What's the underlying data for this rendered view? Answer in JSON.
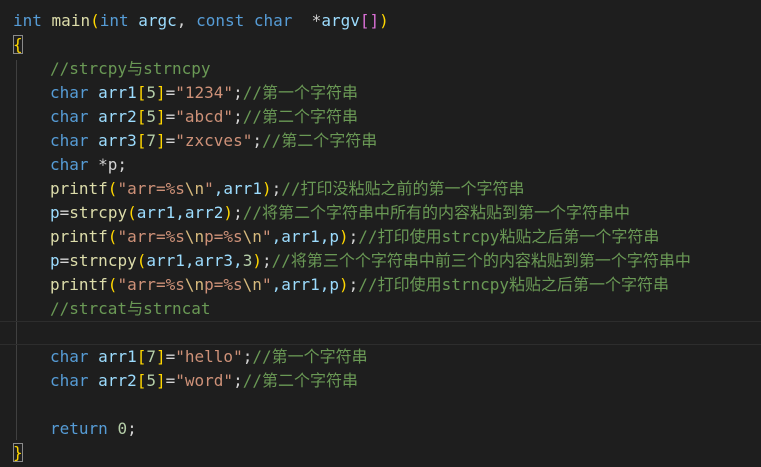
{
  "colors": {
    "background": "#1e1e1e",
    "keyword": "#569cd6",
    "function": "#dcdcaa",
    "variable": "#9cdcfe",
    "number": "#b5cea8",
    "string": "#ce9178",
    "escape": "#d7ba7d",
    "comment": "#6a9955",
    "bracket_gold": "#ffd700",
    "bracket_purple": "#da70d6"
  },
  "code": {
    "l1": {
      "kw_int": "int",
      "fn_main": "main",
      "lp": "(",
      "kw_int2": "int",
      "argc": "argc",
      "comma": ", ",
      "kw_const": "const",
      "kw_char": "char",
      "sp": "  ",
      "star": "*",
      "argv": "argv",
      "lb": "[",
      "rb": "]",
      "rp": ")"
    },
    "l2": {
      "brace": "{"
    },
    "l3": {
      "comment": "//strcpy与strncpy"
    },
    "l4": {
      "ty": "char",
      "var": "arr1",
      "lb": "[",
      "num": "5",
      "rb": "]",
      "eq": "=",
      "str": "\"1234\"",
      "semi": ";",
      "comment": "//第一个字符串"
    },
    "l5": {
      "ty": "char",
      "var": "arr2",
      "lb": "[",
      "num": "5",
      "rb": "]",
      "eq": "=",
      "str": "\"abcd\"",
      "semi": ";",
      "comment": "//第二个字符串"
    },
    "l6": {
      "ty": "char",
      "var": "arr3",
      "lb": "[",
      "num": "7",
      "rb": "]",
      "eq": "=",
      "str": "\"zxcves\"",
      "semi": ";",
      "comment": "//第二个字符串"
    },
    "l7": {
      "ty": "char",
      "rest": " *p;"
    },
    "l8": {
      "fn": "printf",
      "lp": "(",
      "s1": "\"arr=%s",
      "esc": "\\n",
      "s2": "\"",
      "args": ",arr1",
      "rp": ")",
      "semi": ";",
      "comment": "//打印没粘贴之前的第一个字符串"
    },
    "l9": {
      "v": "p",
      "eq": "=",
      "fn": "strcpy",
      "lp": "(",
      "args": "arr1,arr2",
      "rp": ")",
      "semi": ";",
      "comment": "//将第二个字符串中所有的内容粘贴到第一个字符串中"
    },
    "l10": {
      "fn": "printf",
      "lp": "(",
      "s1": "\"arr=%s",
      "esc1": "\\n",
      "s2": "p=%s",
      "esc2": "\\n",
      "s3": "\"",
      "args": ",arr1,p",
      "rp": ")",
      "semi": ";",
      "comment": "//打印使用strcpy粘贴之后第一个字符串"
    },
    "l11": {
      "v": "p",
      "eq": "=",
      "fn": "strncpy",
      "lp": "(",
      "args": "arr1,arr3,",
      "num": "3",
      "rp": ")",
      "semi": ";",
      "comment": "//将第三个个字符串中前三个的内容粘贴到第一个字符串中"
    },
    "l12": {
      "fn": "printf",
      "lp": "(",
      "s1": "\"arr=%s",
      "esc1": "\\n",
      "s2": "p=%s",
      "esc2": "\\n",
      "s3": "\"",
      "args": ",arr1,p",
      "rp": ")",
      "semi": ";",
      "comment": "//打印使用strncpy粘贴之后第一个字符串"
    },
    "l13": {
      "comment": "//strcat与strncat"
    },
    "l15": {
      "ty": "char",
      "var": "arr1",
      "lb": "[",
      "num": "7",
      "rb": "]",
      "eq": "=",
      "str": "\"hello\"",
      "semi": ";",
      "comment": "//第一个字符串"
    },
    "l16": {
      "ty": "char",
      "var": "arr2",
      "lb": "[",
      "num": "5",
      "rb": "]",
      "eq": "=",
      "str": "\"word\"",
      "semi": ";",
      "comment": "//第二个字符串"
    },
    "l18": {
      "kw": "return",
      "num": "0",
      "semi": ";"
    },
    "l19": {
      "brace": "}"
    }
  }
}
